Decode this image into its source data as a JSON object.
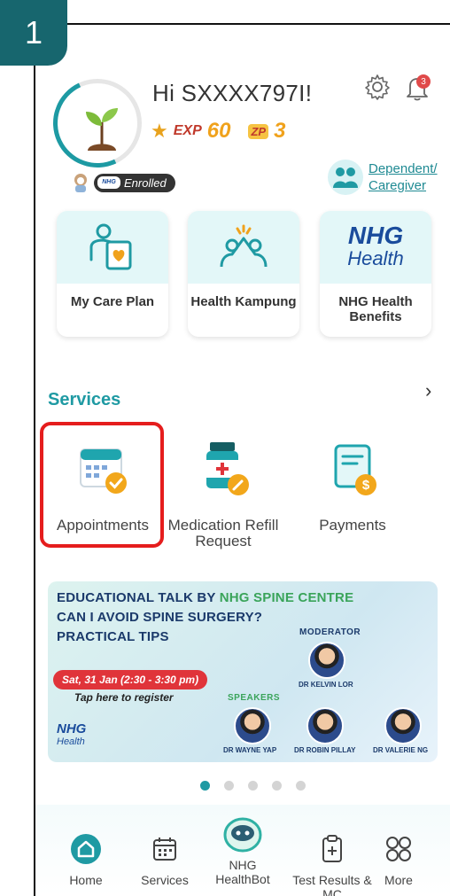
{
  "step": "1",
  "header": {
    "greeting": "Hi SXXXX797I!",
    "exp_tag": "EXP",
    "exp_value": "60",
    "zp_tag": "ZP",
    "zp_value": "3",
    "notification_count": "3",
    "enrolled_label": "Enrolled",
    "nhg_mini_label": "NHG",
    "dependent_line1": "Dependent/",
    "dependent_line2": "Caregiver"
  },
  "quick_cards": [
    {
      "label": "My Care Plan",
      "icon": "care-plan-icon"
    },
    {
      "label": "Health Kampung",
      "icon": "community-icon"
    },
    {
      "label": "NHG Health Benefits",
      "icon": "nhg-health-logo",
      "logo_main": "NHG",
      "logo_sub": "Health"
    }
  ],
  "services": {
    "title": "Services",
    "items": [
      {
        "label": "Appointments",
        "icon": "calendar-check-icon",
        "highlighted": true
      },
      {
        "label": "Medication Refill Request",
        "icon": "medication-bottle-icon"
      },
      {
        "label": "Payments",
        "icon": "payment-document-icon"
      }
    ]
  },
  "banner": {
    "line1_a": "EDUCATIONAL TALK BY ",
    "line1_b": "NHG SPINE CENTRE",
    "line2": "CAN I AVOID SPINE SURGERY?",
    "line3": "PRACTICAL TIPS",
    "moderator_label": "MODERATOR",
    "moderator_name": "DR KELVIN LOR",
    "date": "Sat, 31 Jan (2:30 - 3:30 pm)",
    "register": "Tap here to register",
    "speakers_label": "SPEAKERS",
    "speakers": [
      "DR WAYNE YAP",
      "DR ROBIN PILLAY",
      "DR VALERIE NG"
    ],
    "logo_main": "NHG",
    "logo_sub": "Health"
  },
  "carousel": {
    "count": 5,
    "active_index": 0
  },
  "bottom_nav": [
    {
      "label": "Home",
      "icon": "home-icon"
    },
    {
      "label": "Services",
      "icon": "calendar-grid-icon"
    },
    {
      "label": "NHG HealthBot",
      "icon": "healthbot-icon"
    },
    {
      "label": "Test Results & MC",
      "icon": "clipboard-plus-icon"
    },
    {
      "label": "More",
      "icon": "grid-more-icon"
    }
  ],
  "colors": {
    "accent": "#1f9aa3",
    "highlight": "#e51d1d",
    "badge": "#17666e"
  }
}
